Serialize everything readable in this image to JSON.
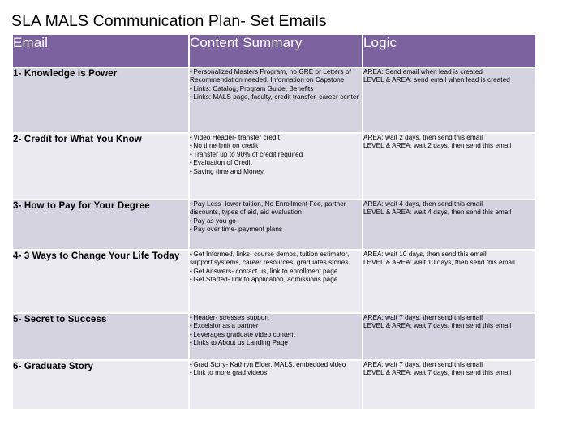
{
  "slide": {
    "title": "SLA MALS Communication Plan- Set Emails",
    "header_color": "#7c629f",
    "row_color_odd": "#d5d3e0",
    "row_color_even": "#ebeaf0"
  },
  "table": {
    "columns": [
      "Email",
      "Content Summary",
      "Logic"
    ],
    "rows": [
      {
        "email": "1-  Knowledge is Power",
        "content": [
          "Personalized Masters Program, no GRE or Letters of Recommendation needed. Information on Capstone",
          "Links: Catalog, Program Guide, Benefits",
          "Links: MALS page, faculty, credit transfer, career center"
        ],
        "logic": [
          "AREA: Send email when lead is created",
          "LEVEL & AREA:  send email when lead is created"
        ]
      },
      {
        "email": "2-  Credit for What You Know",
        "content": [
          "Video Header- transfer credit",
          "No time limit on credit",
          "Transfer up to 90% of credit required",
          "Evaluation of Credit",
          "Saving time and Money"
        ],
        "logic": [
          "AREA: wait 2 days, then send this email",
          "LEVEL & AREA: wait 2 days, then send this email"
        ]
      },
      {
        "email": "3-  How to Pay for Your Degree",
        "content": [
          "Pay Less- lower tuition, No Enrollment Fee, partner discounts, types of aid, aid evaluation",
          "Pay as you go",
          "Pay over time- payment plans"
        ],
        "logic": [
          "AREA: wait 4 days, then send this email",
          "LEVEL & AREA: wait 4 days, then send this email"
        ]
      },
      {
        "email": "4-  3 Ways to Change Your Life Today",
        "content": [
          "Get Informed, links- course demos, tuition estimator, support systems, career resources, graduates stories",
          "Get Answers- contact us, link to enrollment page",
          "Get Started-  link to application, admissions page"
        ],
        "logic": [
          "AREA: wait 10 days, then send this email",
          "LEVEL & AREA:  wait 10 days, then send this email"
        ]
      },
      {
        "email": "5- Secret to Success",
        "content": [
          "Header- stresses support",
          "Excelsior as a partner",
          "Leverages graduate video content",
          "Links to About us Landing Page"
        ],
        "logic": [
          "AREA: wait 7 days, then send this email",
          "LEVEL & AREA: wait 7 days, then send this email"
        ]
      },
      {
        "email": "6- Graduate Story",
        "content": [
          "Grad Story- Kathryn Elder, MALS, embedded video",
          "Link to more grad videos"
        ],
        "logic": [
          "AREA: wait 7 days, then send this email",
          "LEVEL & AREA: wait 7 days, then send this email"
        ]
      }
    ]
  }
}
